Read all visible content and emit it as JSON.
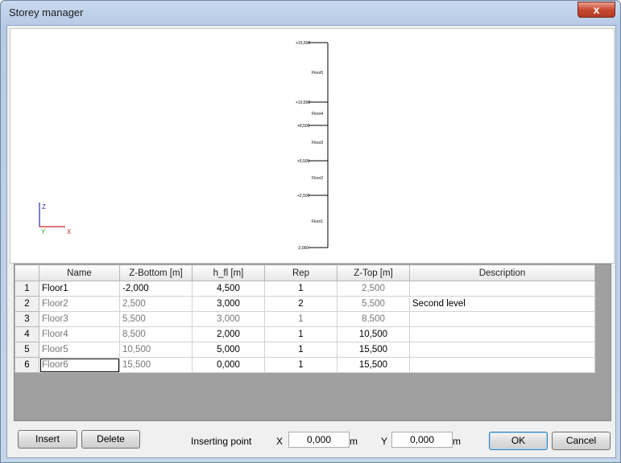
{
  "window": {
    "title": "Storey manager",
    "close_glyph": "x"
  },
  "axes_legend": {
    "z": "Z",
    "y": "Y",
    "x": "X"
  },
  "preview": {
    "levels": [
      {
        "label": "+15,500",
        "floor": "Floor5"
      },
      {
        "label": "+10,500",
        "floor": "Floor4"
      },
      {
        "label": "+8,500",
        "floor": "Floor3"
      },
      {
        "label": "+5,500",
        "floor": "Floor2"
      },
      {
        "label": "+2,500",
        "floor": "Floor1"
      },
      {
        "label": "-2,000",
        "floor": ""
      }
    ]
  },
  "table": {
    "headers": [
      "",
      "Name",
      "Z-Bottom [m]",
      "h_fl [m]",
      "Rep",
      "Z-Top [m]",
      "Description"
    ],
    "rows": [
      {
        "num": "1",
        "name": "Floor1",
        "zbottom": "-2,000",
        "hfl": "4,500",
        "rep": "1",
        "ztop": "2,500",
        "desc": ""
      },
      {
        "num": "2",
        "name": "Floor2",
        "zbottom": "2,500",
        "hfl": "3,000",
        "rep": "2",
        "ztop": "5,500",
        "desc": "Second level"
      },
      {
        "num": "3",
        "name": "Floor3",
        "zbottom": "5,500",
        "hfl": "3,000",
        "rep": "1",
        "ztop": "8,500",
        "desc": ""
      },
      {
        "num": "4",
        "name": "Floor4",
        "zbottom": "8,500",
        "hfl": "2,000",
        "rep": "1",
        "ztop": "10,500",
        "desc": ""
      },
      {
        "num": "5",
        "name": "Floor5",
        "zbottom": "10,500",
        "hfl": "5,000",
        "rep": "1",
        "ztop": "15,500",
        "desc": ""
      },
      {
        "num": "6",
        "name": "Floor6",
        "zbottom": "15,500",
        "hfl": "0,000",
        "rep": "1",
        "ztop": "15,500",
        "desc": ""
      }
    ]
  },
  "footer": {
    "insert_label": "Insert",
    "delete_label": "Delete",
    "inserting_point_label": "Inserting point",
    "x_label": "X",
    "x_value": "0,000",
    "y_label": "Y",
    "y_value": "0,000",
    "unit": "m",
    "ok_label": "OK",
    "cancel_label": "Cancel"
  }
}
